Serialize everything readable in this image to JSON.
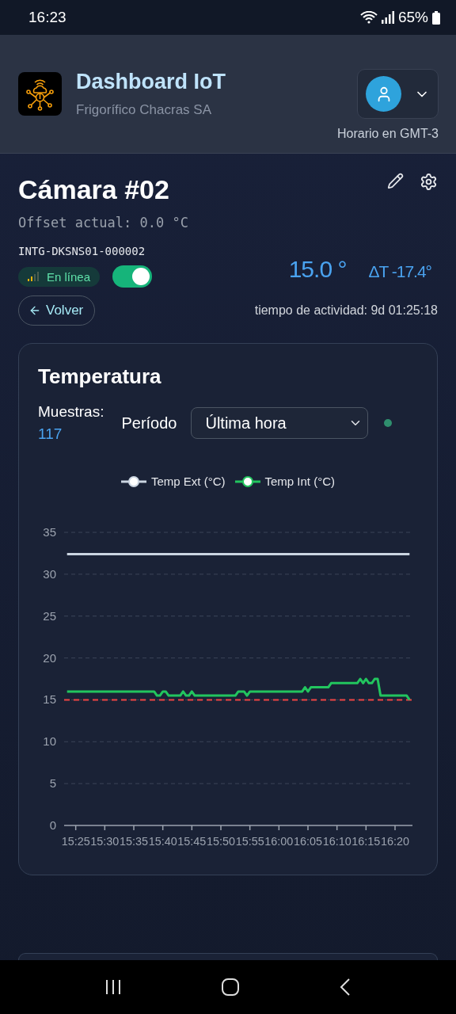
{
  "status_bar": {
    "time": "16:23",
    "battery": "65%"
  },
  "header": {
    "title": "Dashboard IoT",
    "subtitle": "Frigorífico Chacras SA",
    "timezone": "Horario en GMT-3"
  },
  "device": {
    "name": "Cámara #02",
    "offset": "Offset actual: 0.0 °C",
    "serial": "INTG-DKSNS01-000002",
    "status": "En línea",
    "enabled": true,
    "temperature": "15.0 °",
    "delta": "ΔT -17.4°",
    "back": "Volver",
    "uptime": "tiempo de actividad: 9d 01:25:18"
  },
  "temperature_card": {
    "title": "Temperatura",
    "samples_label": "Muestras:",
    "samples": "117",
    "period_label": "Período",
    "period": "Última hora",
    "chart_data": {
      "type": "line",
      "categories": [
        null,
        null,
        null,
        "15:25",
        null,
        null,
        null,
        null,
        null,
        null,
        null,
        null,
        null,
        "15:30",
        null,
        null,
        null,
        null,
        null,
        null,
        null,
        null,
        null,
        "15:35",
        null,
        null,
        null,
        null,
        null,
        null,
        null,
        null,
        null,
        "15:40",
        null,
        null,
        null,
        null,
        null,
        null,
        null,
        null,
        null,
        "15:45",
        null,
        null,
        null,
        null,
        null,
        null,
        null,
        null,
        null,
        "15:50",
        null,
        null,
        null,
        null,
        null,
        null,
        null,
        null,
        null,
        "15:55",
        null,
        null,
        null,
        null,
        null,
        null,
        null,
        null,
        null,
        "16:00",
        null,
        null,
        null,
        null,
        null,
        null,
        null,
        null,
        null,
        "16:05",
        null,
        null,
        null,
        null,
        null,
        null,
        null,
        null,
        null,
        "16:10",
        null,
        null,
        null,
        null,
        null,
        null,
        null,
        null,
        null,
        "16:15",
        null,
        null,
        null,
        null,
        null,
        null,
        null,
        null,
        null,
        "16:20",
        null,
        null,
        null,
        null,
        null
      ],
      "series": [
        {
          "name": "Temp Ext (°C)",
          "color": "#cbd5e1",
          "values": [
            32.4,
            32.4,
            32.4,
            32.4,
            32.4,
            32.4,
            32.4,
            32.4,
            32.4,
            32.4,
            32.4,
            32.4,
            32.4,
            32.4,
            32.4,
            32.4,
            32.4,
            32.4,
            32.4,
            32.4,
            32.4,
            32.4,
            32.4,
            32.4,
            32.4,
            32.4,
            32.4,
            32.4,
            32.4,
            32.4,
            32.4,
            32.4,
            32.4,
            32.4,
            32.4,
            32.4,
            32.4,
            32.4,
            32.4,
            32.4,
            32.4,
            32.4,
            32.4,
            32.4,
            32.4,
            32.4,
            32.4,
            32.4,
            32.4,
            32.4,
            32.4,
            32.4,
            32.4,
            32.4,
            32.4,
            32.4,
            32.4,
            32.4,
            32.4,
            32.4,
            32.4,
            32.4,
            32.4,
            32.4,
            32.4,
            32.4,
            32.4,
            32.4,
            32.4,
            32.4,
            32.4,
            32.4,
            32.4,
            32.4,
            32.4,
            32.4,
            32.4,
            32.4,
            32.4,
            32.4,
            32.4,
            32.4,
            32.4,
            32.4,
            32.4,
            32.4,
            32.4,
            32.4,
            32.4,
            32.4,
            32.4,
            32.4,
            32.4,
            32.4,
            32.4,
            32.4,
            32.4,
            32.4,
            32.4,
            32.4,
            32.4,
            32.4,
            32.4,
            32.4,
            32.4,
            32.4,
            32.4,
            32.4,
            32.4,
            32.4,
            32.4,
            32.4,
            32.4,
            32.4,
            32.4,
            32.4,
            32.4,
            32.4,
            32.4
          ]
        },
        {
          "name": "Temp Int (°C)",
          "color": "#22c55e",
          "values": [
            16,
            16,
            16,
            16,
            16,
            16,
            16,
            16,
            16,
            16,
            16,
            16,
            16,
            16,
            16,
            16,
            16,
            16,
            16,
            16,
            16,
            16,
            16,
            16,
            16,
            16,
            16,
            16,
            16,
            16,
            16,
            15.5,
            15.5,
            16,
            16,
            15.5,
            15.5,
            15.5,
            15.5,
            15.5,
            16,
            15.5,
            15.5,
            16,
            15.5,
            15.5,
            15.5,
            15.5,
            15.5,
            15.5,
            15.5,
            15.5,
            15.5,
            15.5,
            15.5,
            15.5,
            15.5,
            15.5,
            15.5,
            16,
            16,
            16,
            15.5,
            16,
            16,
            16,
            16,
            16,
            16,
            16,
            16,
            16,
            16,
            16,
            16,
            16,
            16,
            16,
            16,
            16,
            16,
            16,
            16.5,
            16,
            16.5,
            16.5,
            16.5,
            16.5,
            16.5,
            16.5,
            16.5,
            17,
            17,
            17,
            17,
            17,
            17,
            17,
            17,
            17,
            17,
            17.5,
            17,
            17.5,
            17,
            17,
            17.5,
            17.5,
            15.5,
            15.5,
            15.5,
            15.5,
            15.5,
            15.5,
            15.5,
            15.5,
            15.5,
            15.5,
            15
          ]
        }
      ],
      "ylim": [
        0,
        35
      ],
      "yticks": [
        0,
        5,
        10,
        15,
        20,
        25,
        30,
        35
      ],
      "grid": true,
      "ref_lines": [
        {
          "axis": "y",
          "value": 15,
          "color": "#ef4444"
        }
      ]
    }
  }
}
